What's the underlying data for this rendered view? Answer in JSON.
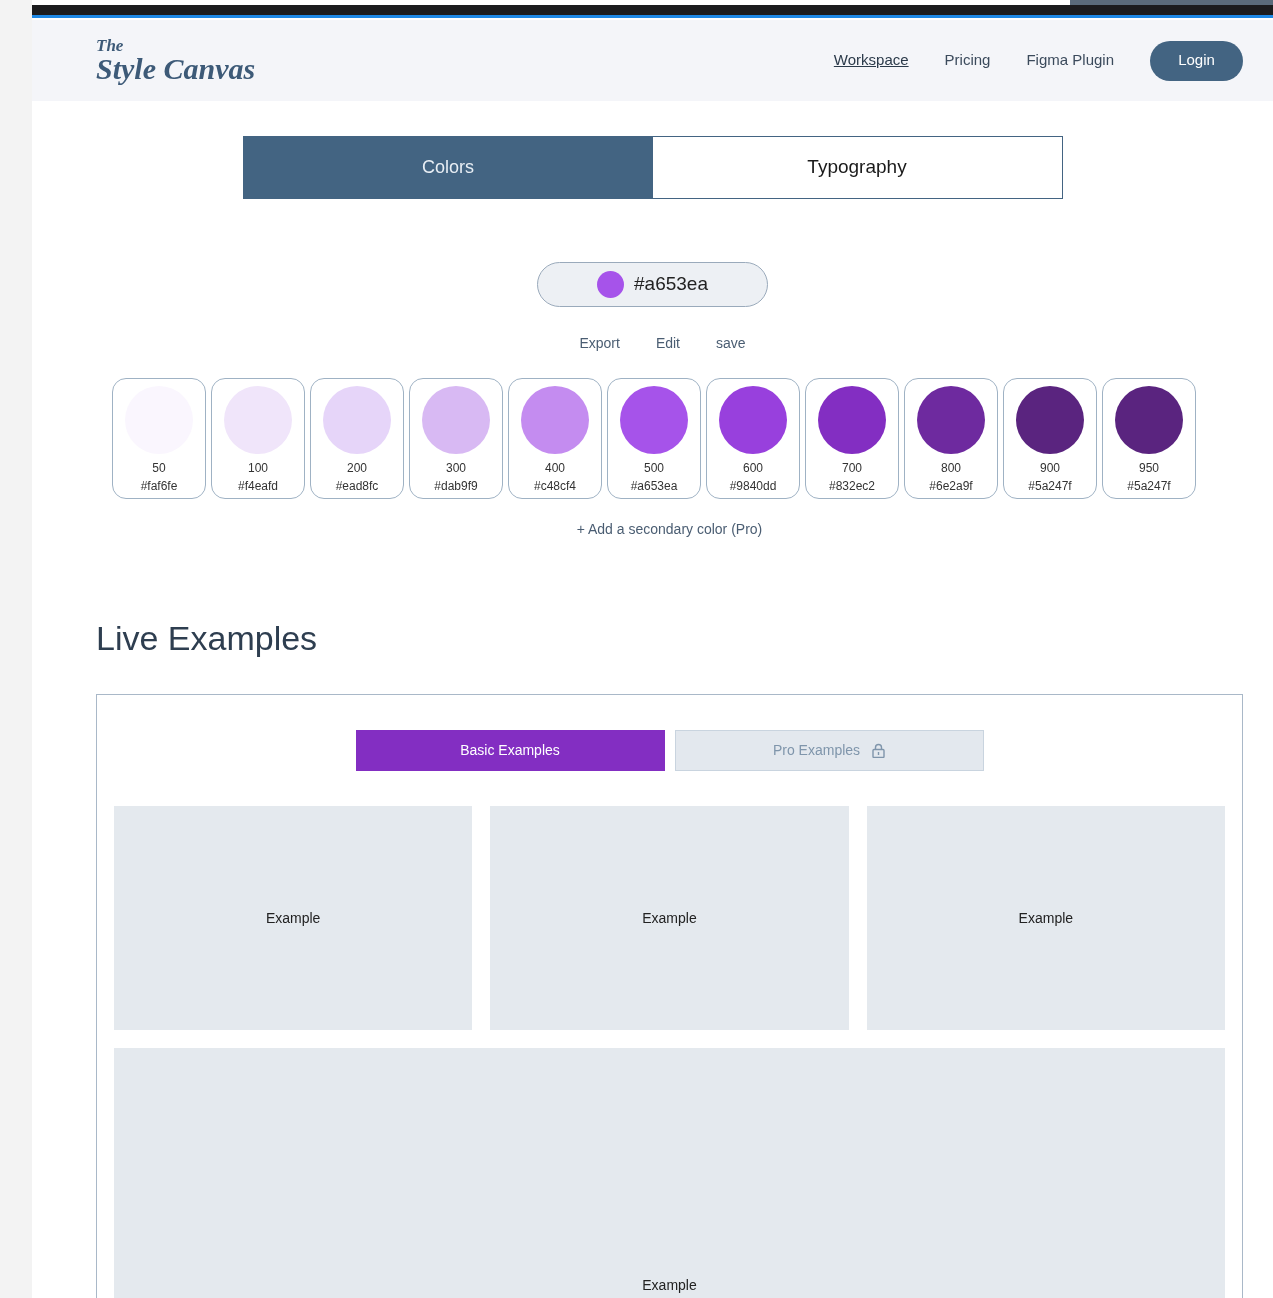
{
  "logo": {
    "small": "The",
    "large": "Style Canvas"
  },
  "nav": [
    {
      "label": "Workspace",
      "selected": true
    },
    {
      "label": "Pricing",
      "selected": false
    },
    {
      "label": "Figma Plugin",
      "selected": false
    }
  ],
  "login": "Login",
  "mode_tabs": [
    {
      "label": "Colors",
      "selected": true
    },
    {
      "label": "Typography",
      "selected": false
    }
  ],
  "base_color": {
    "value": "#a653ea",
    "color": "#a653ea"
  },
  "actions": [
    "Export",
    "Edit",
    "save"
  ],
  "swatches": [
    {
      "shade": "50",
      "hex": "#faf6fe",
      "color": "#faf6fe"
    },
    {
      "shade": "100",
      "hex": "#f4eafd",
      "color": "#f0e5fa"
    },
    {
      "shade": "200",
      "hex": "#ead8fc",
      "color": "#e6d5f9"
    },
    {
      "shade": "300",
      "hex": "#dab9f9",
      "color": "#d8b9f3"
    },
    {
      "shade": "400",
      "hex": "#c48cf4",
      "color": "#c48cf0"
    },
    {
      "shade": "500",
      "hex": "#a653ea",
      "color": "#a653ea"
    },
    {
      "shade": "600",
      "hex": "#9840dd",
      "color": "#9840dd"
    },
    {
      "shade": "700",
      "hex": "#832ec2",
      "color": "#832ec2"
    },
    {
      "shade": "800",
      "hex": "#6e2a9f",
      "color": "#6e2a9f"
    },
    {
      "shade": "900",
      "hex": "#5a247f",
      "color": "#5a247f"
    },
    {
      "shade": "950",
      "hex": "#5a247f",
      "color": "#5a247f"
    }
  ],
  "add_secondary": "+ Add a secondary color (Pro)",
  "live_examples": {
    "title": "Live Examples",
    "tabs": [
      {
        "label": "Basic Examples",
        "selected": true,
        "locked": false
      },
      {
        "label": "Pro Examples",
        "selected": false,
        "locked": true
      }
    ],
    "cards": [
      "Example",
      "Example",
      "Example",
      "Example"
    ]
  }
}
